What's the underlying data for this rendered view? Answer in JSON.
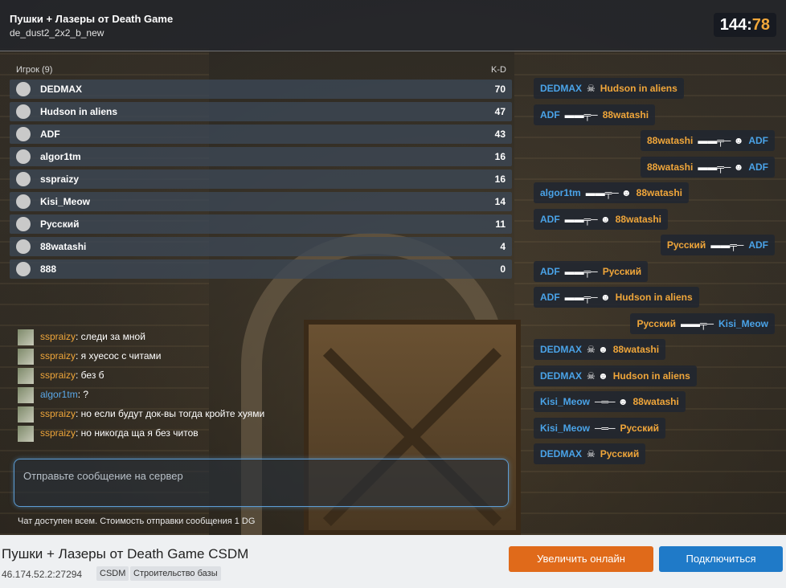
{
  "server": {
    "title": "Пушки + Лазеры от Death Game",
    "map": "de_dust2_2x2_b_new"
  },
  "timer": {
    "minutes": "144",
    "seconds": "78"
  },
  "scoreboard": {
    "header": "Игрок (9)",
    "kd_label": "K-D",
    "players": [
      {
        "name": "DEDMAX",
        "score": "70"
      },
      {
        "name": "Hudson in aliens",
        "score": "47"
      },
      {
        "name": "ADF",
        "score": "43"
      },
      {
        "name": "algor1tm",
        "score": "16"
      },
      {
        "name": "sspraizy",
        "score": "16"
      },
      {
        "name": "Kisi_Meow",
        "score": "14"
      },
      {
        "name": "Русский",
        "score": "11"
      },
      {
        "name": "88watashi",
        "score": "4"
      },
      {
        "name": "888",
        "score": "0"
      }
    ]
  },
  "chat": {
    "messages": [
      {
        "user": "sspraizy",
        "text": ": следи за мной",
        "color": "orange"
      },
      {
        "user": "sspraizy",
        "text": ": я хуесос с читами",
        "color": "orange"
      },
      {
        "user": "sspraizy",
        "text": ": без б",
        "color": "orange"
      },
      {
        "user": "algor1tm",
        "text": ": ?",
        "color": "blue"
      },
      {
        "user": "sspraizy",
        "text": ": но если будут док-вы тогда кройте хуями",
        "color": "orange"
      },
      {
        "user": "sspraizy",
        "text": ": но никогда ща я без читов",
        "color": "orange"
      }
    ],
    "placeholder": "Отправьте сообщение на сервер",
    "note": "Чат доступен всем. Стоимость отправки сообщения 1 DG"
  },
  "killfeed": [
    {
      "attacker": "DEDMAX",
      "victim": "Hudson in aliens",
      "attacker_color": "#4aa3e8",
      "victim_color": "#f0a63a",
      "weapon": "skull-icon"
    },
    {
      "attacker": "ADF",
      "victim": "88watashi",
      "attacker_color": "#4aa3e8",
      "victim_color": "#f0a63a",
      "weapon": "rifle-icon"
    },
    {
      "attacker": "88watashi",
      "victim": "ADF",
      "attacker_color": "#f0a63a",
      "victim_color": "#4aa3e8",
      "weapon": "rifle-headshot-icon"
    },
    {
      "attacker": "88watashi",
      "victim": "ADF",
      "attacker_color": "#f0a63a",
      "victim_color": "#4aa3e8",
      "weapon": "rifle-headshot-icon"
    },
    {
      "attacker": "algor1tm",
      "victim": "88watashi",
      "attacker_color": "#4aa3e8",
      "victim_color": "#f0a63a",
      "weapon": "rifle-headshot-icon"
    },
    {
      "attacker": "ADF",
      "victim": "88watashi",
      "attacker_color": "#4aa3e8",
      "victim_color": "#f0a63a",
      "weapon": "rifle-headshot-icon"
    },
    {
      "attacker": "Русский",
      "victim": "ADF",
      "attacker_color": "#f0a63a",
      "victim_color": "#4aa3e8",
      "weapon": "rifle-icon"
    },
    {
      "attacker": "ADF",
      "victim": "Русский",
      "attacker_color": "#4aa3e8",
      "victim_color": "#f0a63a",
      "weapon": "rifle-icon"
    },
    {
      "attacker": "ADF",
      "victim": "Hudson in aliens",
      "attacker_color": "#4aa3e8",
      "victim_color": "#f0a63a",
      "weapon": "rifle-headshot-icon"
    },
    {
      "attacker": "Русский",
      "victim": "Kisi_Meow",
      "attacker_color": "#f0a63a",
      "victim_color": "#4aa3e8",
      "weapon": "rifle-icon"
    },
    {
      "attacker": "DEDMAX",
      "victim": "88watashi",
      "attacker_color": "#4aa3e8",
      "victim_color": "#f0a63a",
      "weapon": "skull-headshot-icon"
    },
    {
      "attacker": "DEDMAX",
      "victim": "Hudson in aliens",
      "attacker_color": "#4aa3e8",
      "victim_color": "#f0a63a",
      "weapon": "skull-headshot-icon"
    },
    {
      "attacker": "Kisi_Meow",
      "victim": "88watashi",
      "attacker_color": "#4aa3e8",
      "victim_color": "#f0a63a",
      "weapon": "laser-headshot-icon"
    },
    {
      "attacker": "Kisi_Meow",
      "victim": "Русский",
      "attacker_color": "#4aa3e8",
      "victim_color": "#f0a63a",
      "weapon": "laser-icon"
    },
    {
      "attacker": "DEDMAX",
      "victim": "Русский",
      "attacker_color": "#4aa3e8",
      "victim_color": "#f0a63a",
      "weapon": "skull-icon"
    }
  ],
  "footer": {
    "title": "Пушки + Лазеры от Death Game CSDM",
    "ip": "46.174.52.2:27294",
    "tags": [
      "CSDM",
      "Строительство базы"
    ],
    "boost_button": "Увеличить онлайн",
    "connect_button": "Подключиться"
  }
}
